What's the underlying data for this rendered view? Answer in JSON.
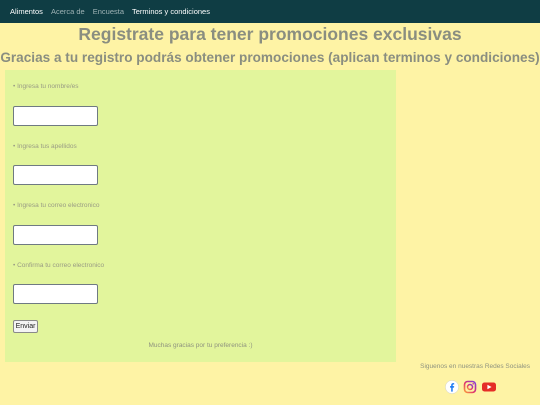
{
  "navbar": {
    "links": [
      {
        "label": "Alimentos"
      },
      {
        "label": "Acerca de"
      },
      {
        "label": "Encuesta"
      },
      {
        "label": "Terminos y condiciones"
      }
    ]
  },
  "header": {
    "title": "Registrate para tener promociones exclusivas",
    "subtitle": "Gracias a tu registro podrás obtener promociones (aplican terminos y condiciones)"
  },
  "form": {
    "fields": [
      {
        "label": "• Ingresa tu nombre/es",
        "value": ""
      },
      {
        "label": "• Ingresa tus apellidos",
        "value": ""
      },
      {
        "label": "• Ingresa tu correo electronico",
        "value": ""
      },
      {
        "label": "• Confirma tu correo electronico",
        "value": ""
      }
    ],
    "submit_label": "Enviar",
    "thanks": "Muchas gracias por tu preferencia :)"
  },
  "social": {
    "heading": "Siguenos en nuestras Redes Sociales",
    "icons": [
      "facebook-icon",
      "instagram-icon",
      "youtube-icon"
    ]
  },
  "colors": {
    "page_bg": "#fef3a5",
    "navbar_bg": "#0f3d44",
    "form_bg": "#e2f59c",
    "youtube_red": "#e52d27"
  }
}
